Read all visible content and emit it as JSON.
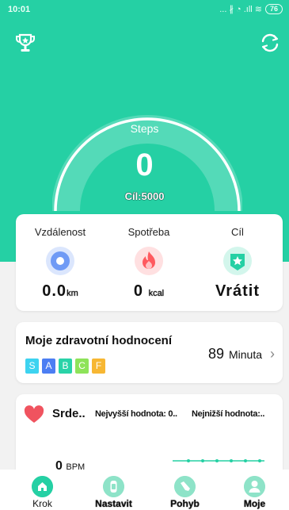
{
  "statusbar": {
    "time": "10:01",
    "indicators": "... ∦ ◔ .ıll ≋",
    "battery": "76"
  },
  "header": {
    "left_icon": "trophy-icon",
    "right_icon": "sync-icon"
  },
  "steps": {
    "label": "Steps",
    "value": "0",
    "goal": "Cíl:5000",
    "progress": 0
  },
  "stats": [
    {
      "label": "Vzdálenost",
      "value": "0.0",
      "unit": "km",
      "icon": "location-icon",
      "color": "#5b8cf2"
    },
    {
      "label": "Spotřeba",
      "value": "0",
      "unit": "kcal",
      "icon": "flame-icon",
      "color": "#ff5a5f"
    },
    {
      "label": "Cíl",
      "value": "Vrátit",
      "unit": "",
      "icon": "star-badge-icon",
      "color": "#25d0a4"
    }
  ],
  "health": {
    "title": "Moje zdravotní hodnocení",
    "grades": [
      {
        "letter": "S",
        "color": "#3dd3f0"
      },
      {
        "letter": "A",
        "color": "#4c7ef3"
      },
      {
        "letter": "B",
        "color": "#29d3a8"
      },
      {
        "letter": "C",
        "color": "#8ee35a"
      },
      {
        "letter": "F",
        "color": "#f7b733"
      }
    ],
    "value": "89",
    "unit": "Minuta"
  },
  "heart": {
    "title": "Srde..",
    "max_label": "Nejvyšší hodnota: 0..",
    "min_label": "Nejnižší hodnota:..",
    "value": "0",
    "unit": "BPM"
  },
  "nav": [
    {
      "label": "Krok",
      "icon": "home-icon",
      "active": true
    },
    {
      "label": "Nastavit",
      "icon": "watch-icon",
      "active": false
    },
    {
      "label": "Pohyb",
      "icon": "shoe-icon",
      "active": false
    },
    {
      "label": "Moje",
      "icon": "person-icon",
      "active": false
    }
  ],
  "colors": {
    "accent": "#25d0a4",
    "background": "#f2f2f2"
  }
}
